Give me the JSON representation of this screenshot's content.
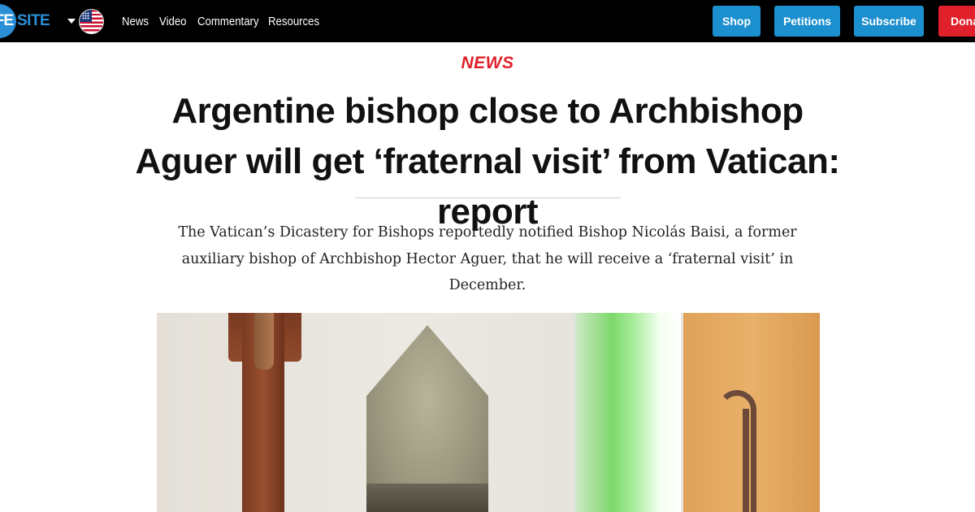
{
  "header": {
    "logo_left": "IFE",
    "logo_right": "SITE",
    "region_flag": "us-flag-icon",
    "nav_links": [
      "News",
      "Video",
      "Commentary",
      "Resources"
    ],
    "buttons": {
      "shop": "Shop",
      "petitions": "Petitions",
      "subscribe": "Subscribe",
      "donate": "Donat"
    },
    "colors": {
      "bar": "#000000",
      "accent": "#1c8fcf",
      "donate": "#e0202a"
    }
  },
  "article": {
    "section": "NEWS",
    "headline": "Argentine bishop close to Archbishop Aguer will get ‘fraternal visit’ from Vatican: report",
    "summary": "The Vatican’s Dicastery for Bishops reportedly notified Bishop Nicolás Baisi, a former auxiliary bishop of Archbishop Hector Aguer, that he will receive a ‘fraternal visit’ in December.",
    "section_color": "#e0202a"
  }
}
